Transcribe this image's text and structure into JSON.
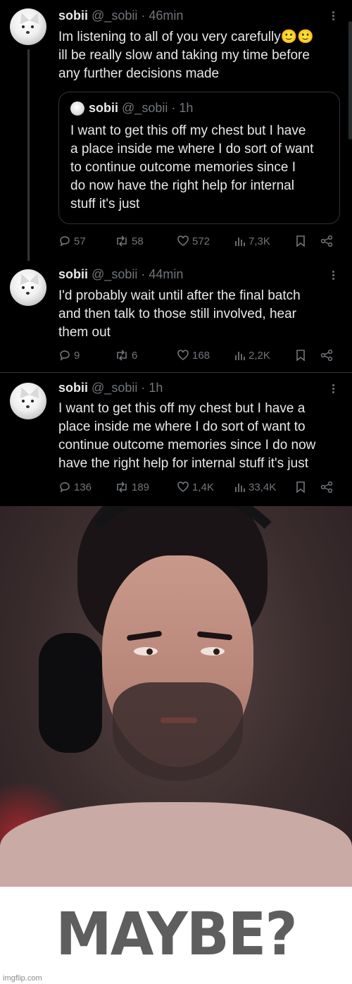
{
  "feed": {
    "tweets": [
      {
        "name": "sobii",
        "meta": "@_sobii · 46min",
        "text_lines": [
          "Im listening to all of you very carefully🙂🙂",
          "ill be really slow and taking my time before",
          "any further decisions made"
        ],
        "quote": {
          "name": "sobii",
          "meta": "@_sobii · 1h",
          "text_lines": [
            "I want to get this off my chest but I have",
            "a place inside me where I do sort of want",
            "to continue outcome memories since I",
            "do now have the right help for internal",
            "stuff   it's just"
          ]
        },
        "stats": {
          "replies": "57",
          "reposts": "58",
          "likes": "572",
          "views": "7,3K"
        }
      },
      {
        "name": "sobii",
        "meta": "@_sobii · 44min",
        "text_lines": [
          "I'd probably wait until after the final batch",
          "and then talk to those still involved, hear",
          "them out"
        ],
        "stats": {
          "replies": "9",
          "reposts": "6",
          "likes": "168",
          "views": "2,2K"
        }
      },
      {
        "name": "sobii",
        "meta": "@_sobii · 1h",
        "text_lines": [
          "I want to get this off my chest but I have a",
          "place inside me where I do sort of want to",
          "continue outcome memories since I do now",
          "have the right help for internal stuff   it's just"
        ],
        "stats": {
          "replies": "136",
          "reposts": "189",
          "likes": "1,4K",
          "views": "33,4K"
        }
      }
    ]
  },
  "meme": {
    "caption": "MAYBE?",
    "watermark": "imgflip.com"
  },
  "icons": [
    "reply-icon",
    "repost-icon",
    "like-icon",
    "views-icon",
    "bookmark-icon",
    "share-icon",
    "more-icon"
  ],
  "colors": {
    "background": "#000000",
    "text": "#e7e9ea",
    "muted": "#71767b",
    "border": "#2f3336"
  }
}
